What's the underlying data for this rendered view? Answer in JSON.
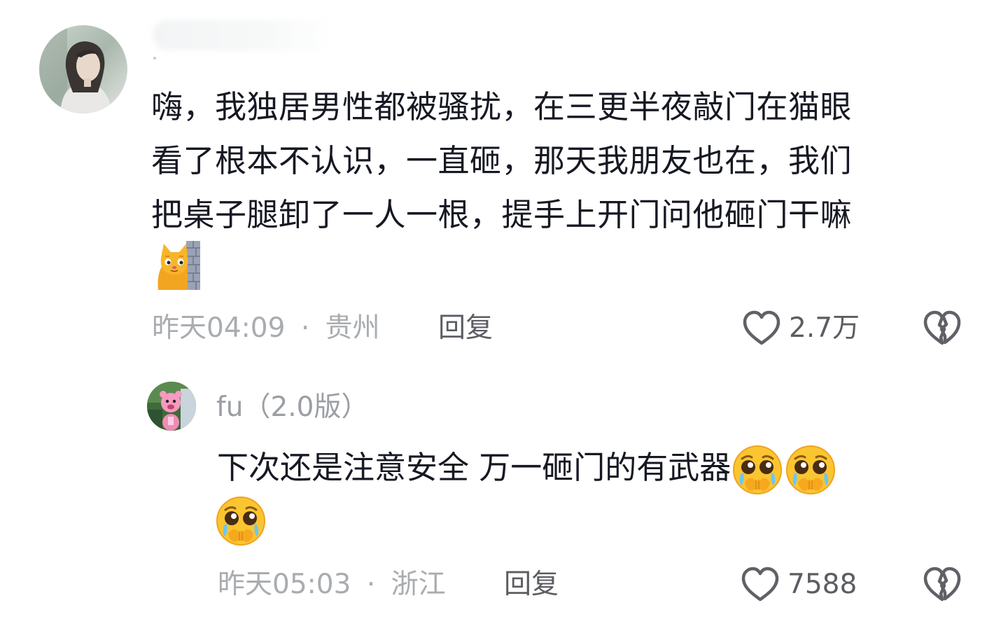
{
  "comment": {
    "author_name": "",
    "lines": [
      "嗨，我独居男性都被骚扰，在三更半夜敲门在猫眼",
      "看了根本不认识，一直砸，那天我朋友也在，我们",
      "把桌子腿卸了一人一根，提手上开门问他砸门干嘛"
    ],
    "sticker": "cat-peeking-behind-wall-sticker",
    "time": "昨天04:09",
    "separator": "·",
    "location": "贵州",
    "reply_label": "回复",
    "like_count": "2.7万",
    "like_icon": "heart-outline-icon",
    "dislike_icon": "broken-heart-icon"
  },
  "reply": {
    "author_name": "fu（2.0版）",
    "text": "下次还是注意安全 万一砸门的有武器",
    "emoji": "pleading-face-holding-back-tears-emoji",
    "emoji_count": 3,
    "time": "昨天05:03",
    "separator": "·",
    "location": "浙江",
    "reply_label": "回复",
    "like_count": "7588",
    "like_icon": "heart-outline-icon",
    "dislike_icon": "broken-heart-icon"
  },
  "colors": {
    "text_primary": "#161823",
    "text_meta": "#a9acb0",
    "text_secondary": "#5b5d63",
    "icon_gray": "#5f6166"
  }
}
